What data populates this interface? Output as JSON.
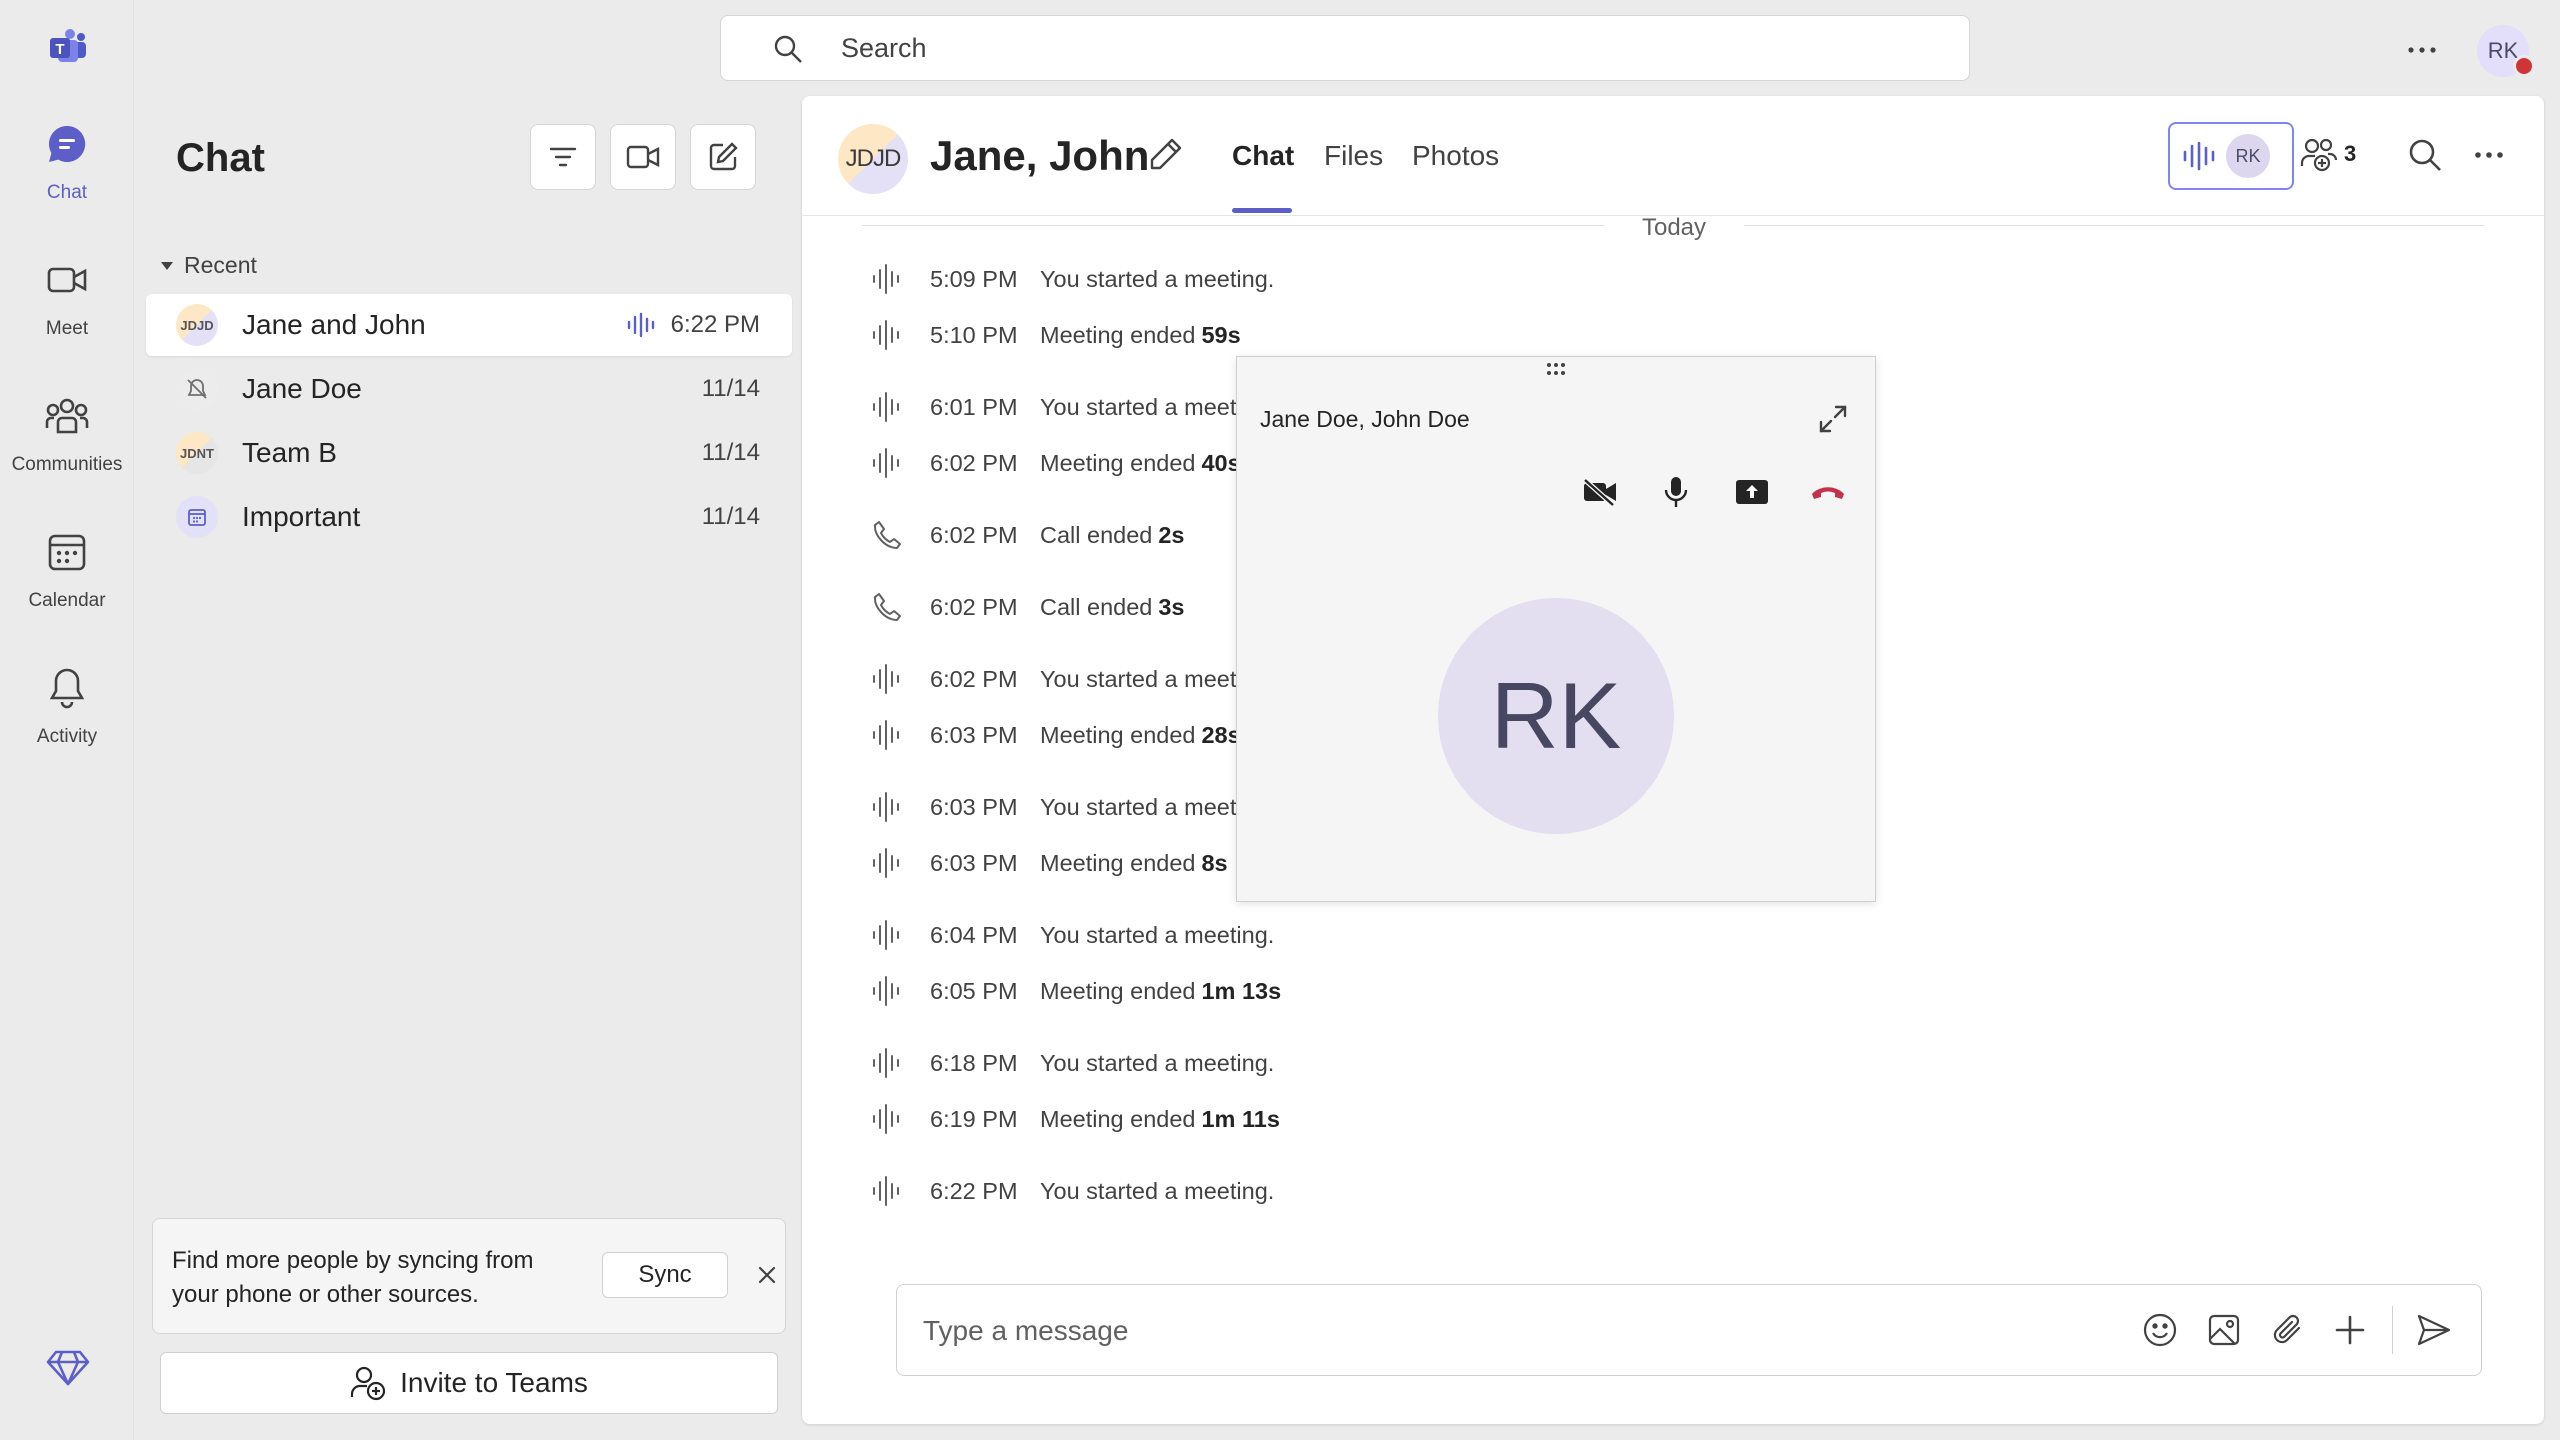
{
  "rail": {
    "items": [
      {
        "label": "Chat",
        "icon": "chat-icon",
        "active": true
      },
      {
        "label": "Meet",
        "icon": "video-camera-icon"
      },
      {
        "label": "Communities",
        "icon": "communities-icon"
      },
      {
        "label": "Calendar",
        "icon": "calendar-icon"
      },
      {
        "label": "Activity",
        "icon": "bell-icon"
      }
    ]
  },
  "search": {
    "placeholder": "Search"
  },
  "user": {
    "initials": "RK"
  },
  "chat_list": {
    "title": "Chat",
    "section_label": "Recent",
    "items": [
      {
        "name": "Jane and John",
        "time": "6:22 PM",
        "avatar": "JDJD",
        "selected": true,
        "live": true
      },
      {
        "name": "Jane Doe",
        "time": "11/14",
        "avatar": "muted"
      },
      {
        "name": "Team B",
        "time": "11/14",
        "avatar": "JDNT"
      },
      {
        "name": "Important",
        "time": "11/14",
        "avatar": "calendar"
      }
    ],
    "sync": {
      "text": "Find more people by syncing from your phone or other sources.",
      "button": "Sync"
    },
    "invite_label": "Invite to Teams"
  },
  "conversation": {
    "avatar": "JDJD",
    "title": "Jane, John",
    "tabs": [
      "Chat",
      "Files",
      "Photos"
    ],
    "active_tab": "Chat",
    "call_participant": "RK",
    "participant_count": "3",
    "divider_label": "Today",
    "messages": [
      {
        "time": "5:09 PM",
        "text": "You started a meeting.",
        "duration": "",
        "kind": "meeting"
      },
      {
        "time": "5:10 PM",
        "text": "Meeting ended",
        "duration": "59s",
        "kind": "meeting"
      },
      {
        "time": "6:01 PM",
        "text": "You started a meeting.",
        "duration": "",
        "kind": "meeting"
      },
      {
        "time": "6:02 PM",
        "text": "Meeting ended",
        "duration": "40s",
        "kind": "meeting"
      },
      {
        "time": "6:02 PM",
        "text": "Call ended",
        "duration": "2s",
        "kind": "call"
      },
      {
        "time": "6:02 PM",
        "text": "Call ended",
        "duration": "3s",
        "kind": "call"
      },
      {
        "time": "6:02 PM",
        "text": "You started a meeting.",
        "duration": "",
        "kind": "meeting"
      },
      {
        "time": "6:03 PM",
        "text": "Meeting ended",
        "duration": "28s",
        "kind": "meeting"
      },
      {
        "time": "6:03 PM",
        "text": "You started a meeting.",
        "duration": "",
        "kind": "meeting"
      },
      {
        "time": "6:03 PM",
        "text": "Meeting ended",
        "duration": "8s",
        "kind": "meeting"
      },
      {
        "time": "6:04 PM",
        "text": "You started a meeting.",
        "duration": "",
        "kind": "meeting"
      },
      {
        "time": "6:05 PM",
        "text": "Meeting ended",
        "duration": "1m 13s",
        "kind": "meeting"
      },
      {
        "time": "6:18 PM",
        "text": "You started a meeting.",
        "duration": "",
        "kind": "meeting"
      },
      {
        "time": "6:19 PM",
        "text": "Meeting ended",
        "duration": "1m 11s",
        "kind": "meeting"
      },
      {
        "time": "6:22 PM",
        "text": "You started a meeting.",
        "duration": "",
        "kind": "meeting"
      }
    ],
    "compose_placeholder": "Type a message"
  },
  "call_window": {
    "title": "Jane Doe, John Doe",
    "avatar_initials": "RK",
    "controls": [
      "camera-off-icon",
      "microphone-icon",
      "share-screen-icon",
      "hang-up-icon"
    ]
  },
  "colors": {
    "accent": "#5b5fc7",
    "hangup": "#c4314b",
    "presence_busy": "#d13438"
  }
}
